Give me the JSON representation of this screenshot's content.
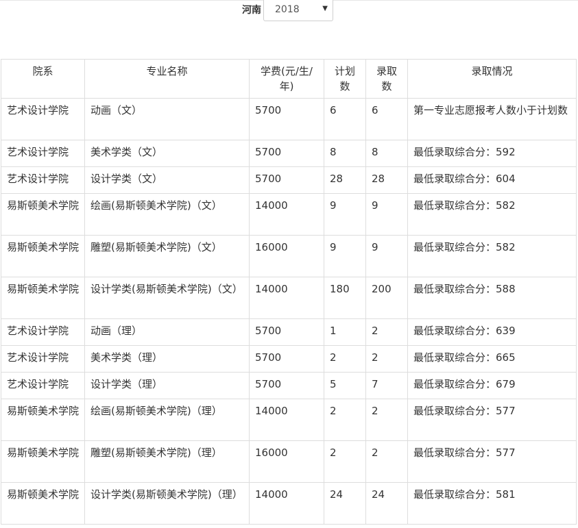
{
  "filter": {
    "province_label": "河南",
    "year_value": "2018",
    "caret": "▼"
  },
  "table": {
    "headers": [
      "院系",
      "专业名称",
      "学费(元/生/年)",
      "计划数",
      "录取数",
      "录取情况"
    ],
    "rows": [
      {
        "dept": "艺术设计学院",
        "major": "动画（文）",
        "fee": "5700",
        "plan": "6",
        "admitted": "6",
        "status": "第一专业志愿报考人数小于计划数"
      },
      {
        "dept": "艺术设计学院",
        "major": "美术学类（文）",
        "fee": "5700",
        "plan": "8",
        "admitted": "8",
        "status": "最低录取综合分：592"
      },
      {
        "dept": "艺术设计学院",
        "major": "设计学类（文）",
        "fee": "5700",
        "plan": "28",
        "admitted": "28",
        "status": "最低录取综合分：604"
      },
      {
        "dept": "易斯顿美术学院",
        "major": "绘画(易斯顿美术学院)（文）",
        "fee": "14000",
        "plan": "9",
        "admitted": "9",
        "status": "最低录取综合分：582"
      },
      {
        "dept": "易斯顿美术学院",
        "major": "雕塑(易斯顿美术学院)（文）",
        "fee": "16000",
        "plan": "9",
        "admitted": "9",
        "status": "最低录取综合分：582"
      },
      {
        "dept": "易斯顿美术学院",
        "major": "设计学类(易斯顿美术学院)（文）",
        "fee": "14000",
        "plan": "180",
        "admitted": "200",
        "status": "最低录取综合分：588"
      },
      {
        "dept": "艺术设计学院",
        "major": "动画（理）",
        "fee": "5700",
        "plan": "1",
        "admitted": "2",
        "status": "最低录取综合分：639"
      },
      {
        "dept": "艺术设计学院",
        "major": "美术学类（理）",
        "fee": "5700",
        "plan": "2",
        "admitted": "2",
        "status": "最低录取综合分：665"
      },
      {
        "dept": "艺术设计学院",
        "major": "设计学类（理）",
        "fee": "5700",
        "plan": "5",
        "admitted": "7",
        "status": "最低录取综合分：679"
      },
      {
        "dept": "易斯顿美术学院",
        "major": "绘画(易斯顿美术学院)（理）",
        "fee": "14000",
        "plan": "2",
        "admitted": "2",
        "status": "最低录取综合分：577"
      },
      {
        "dept": "易斯顿美术学院",
        "major": "雕塑(易斯顿美术学院)（理）",
        "fee": "16000",
        "plan": "2",
        "admitted": "2",
        "status": "最低录取综合分：577"
      },
      {
        "dept": "易斯顿美术学院",
        "major": "设计学类(易斯顿美术学院)（理）",
        "fee": "14000",
        "plan": "24",
        "admitted": "24",
        "status": "最低录取综合分：581"
      }
    ]
  }
}
